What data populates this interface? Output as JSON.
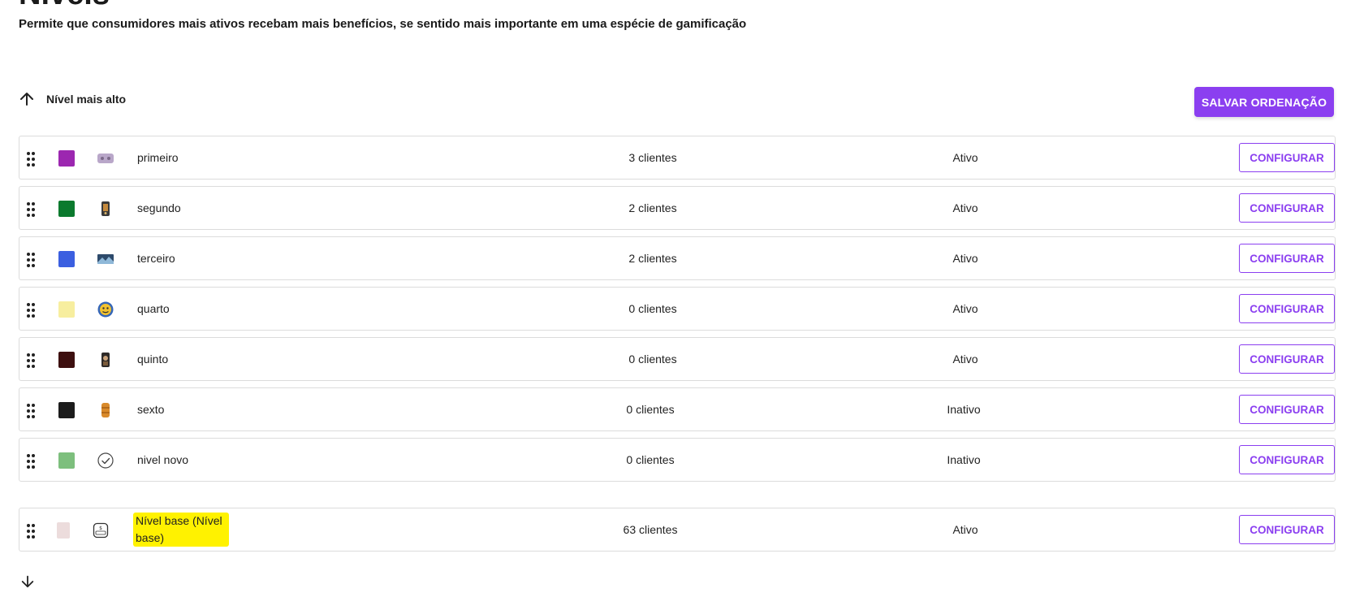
{
  "page": {
    "title": "Níveis",
    "subtitle": "Permite que consumidores mais ativos recebam mais benefícios, se sentido mais importante em uma espécie de gamificação"
  },
  "sort": {
    "top_label": "Nível mais alto",
    "save_label": "SALVAR ORDENAÇÃO"
  },
  "levels": [
    {
      "name": "primeiro",
      "clients": "3 clientes",
      "status": "Ativo",
      "color": "#9c27b0",
      "icon": "gamepad-image-icon",
      "configure_label": "CONFIGURAR"
    },
    {
      "name": "segundo",
      "clients": "2 clientes",
      "status": "Ativo",
      "color": "#0b7a2e",
      "icon": "character-image-icon",
      "configure_label": "CONFIGURAR"
    },
    {
      "name": "terceiro",
      "clients": "2 clientes",
      "status": "Ativo",
      "color": "#3b5fe0",
      "icon": "landscape-image-icon",
      "configure_label": "CONFIGURAR"
    },
    {
      "name": "quarto",
      "clients": "0 clientes",
      "status": "Ativo",
      "color": "#f7ee9f",
      "icon": "emoji-image-icon",
      "configure_label": "CONFIGURAR"
    },
    {
      "name": "quinto",
      "clients": "0 clientes",
      "status": "Ativo",
      "color": "#3d0f0f",
      "icon": "portrait-image-icon",
      "configure_label": "CONFIGURAR"
    },
    {
      "name": "sexto",
      "clients": "0 clientes",
      "status": "Inativo",
      "color": "#1c1c1c",
      "icon": "jar-image-icon",
      "configure_label": "CONFIGURAR"
    },
    {
      "name": "nivel novo",
      "clients": "0 clientes",
      "status": "Inativo",
      "color": "#7dbf7d",
      "icon": "check-circle-icon",
      "configure_label": "CONFIGURAR"
    }
  ],
  "base_level": {
    "name": "Nível base (Nível base)",
    "clients": "63 clientes",
    "status": "Ativo",
    "color": "#ecdcdc",
    "icon": "level-badge-icon",
    "configure_label": "CONFIGURAR"
  }
}
